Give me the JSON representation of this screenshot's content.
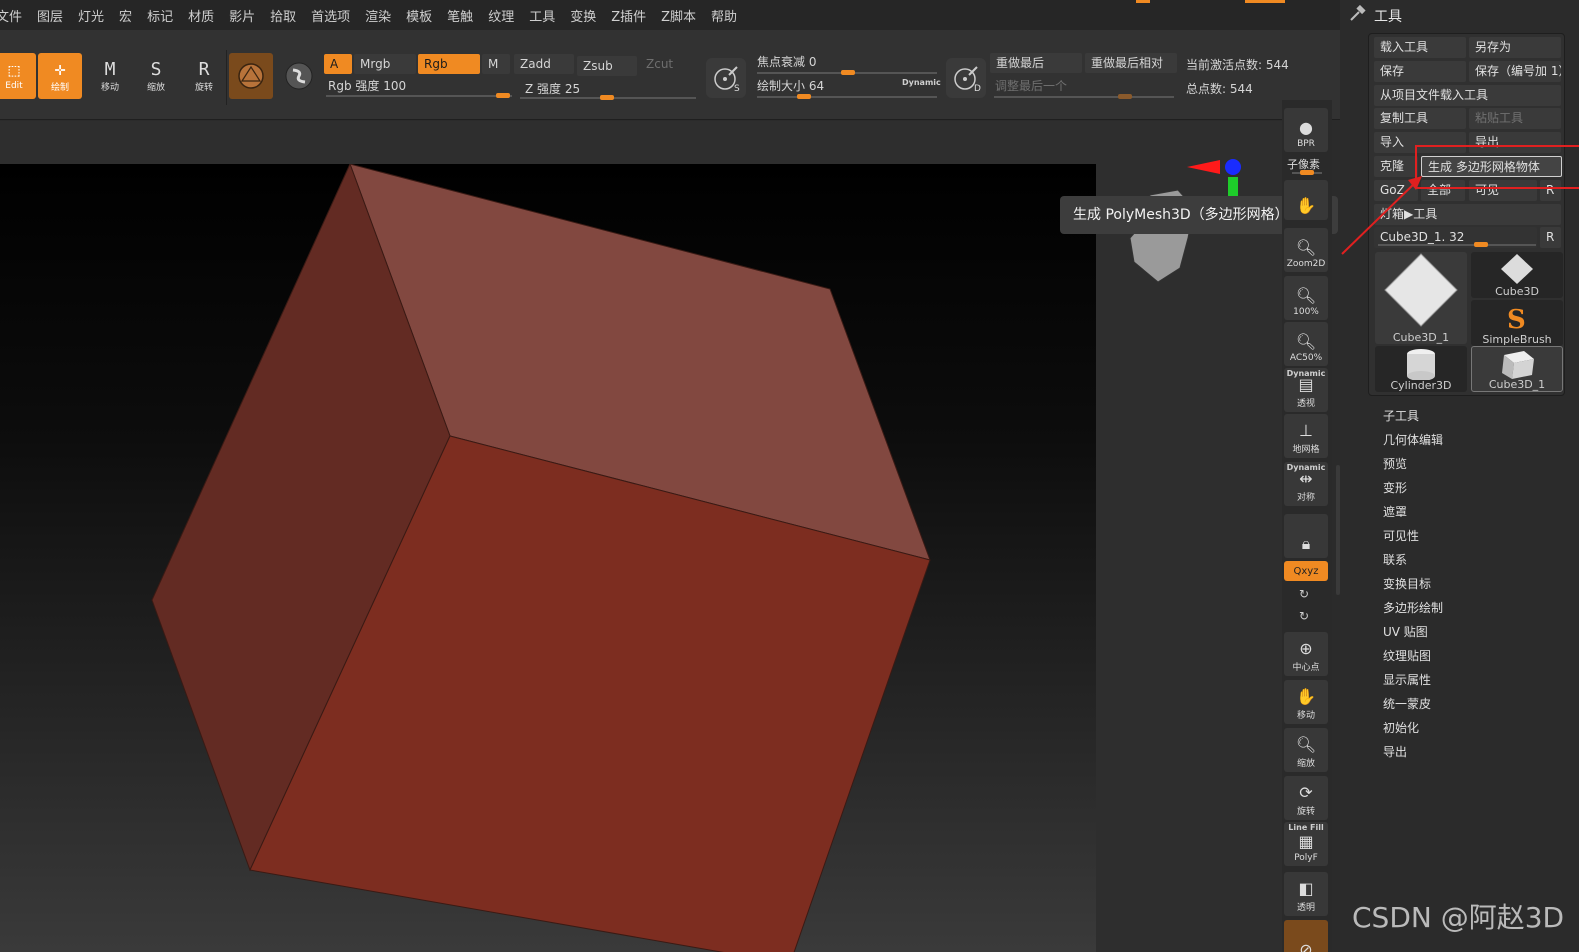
{
  "menu": [
    "文件",
    "图层",
    "灯光",
    "宏",
    "标记",
    "材质",
    "影片",
    "拾取",
    "首选项",
    "渲染",
    "模板",
    "笔触",
    "纹理",
    "工具",
    "变换",
    "Z插件",
    "Z脚本",
    "帮助"
  ],
  "toolbar": {
    "edit_label": "Edit",
    "draw_label": "绘制",
    "move_label": "移动",
    "scale_label": "缩放",
    "rotate_label": "旋转",
    "a_label": "A",
    "mrgb_label": "Mrgb",
    "rgb_label": "Rgb",
    "m_label": "M",
    "rgb_intensity": "Rgb 强度 100",
    "zadd_label": "Zadd",
    "zsub_label": "Zsub",
    "zcut_label": "Zcut",
    "z_intensity": "Z 强度 25",
    "focal_shift": "焦点衰减 0",
    "draw_size": "绘制大小 64",
    "dynamic_label": "Dynamic",
    "redo_last": "重做最后",
    "redo_last_relative": "重做最后相对",
    "adjust_last": "调整最后一个",
    "active_points": "当前激活点数: 544",
    "total_points": "总点数: 544",
    "s_label": "S",
    "d_label": "D"
  },
  "tooltip": "生成 PolyMesh3D（多边形网格）工具",
  "right_strip": {
    "bpr": "BPR",
    "subpixel": "子像素",
    "zoom2d": "Zoom2D",
    "actual": "100%",
    "ac50": "AC50%",
    "persp_dyn": "Dynamic",
    "persp": "透视",
    "floor": "地网格",
    "sym_dyn": "Dynamic",
    "sym": "对称",
    "xyz": "Qxyz",
    "center": "中心点",
    "move": "移动",
    "zoom": "缩放",
    "rotate": "旋转",
    "linefill": "Line Fill",
    "polyf": "PolyF",
    "transp": "透明"
  },
  "panel": {
    "title": "工具",
    "load_tool": "载入工具",
    "save_as": "另存为",
    "save": "保存",
    "save_inc": "保存（编号加 1）",
    "load_from_project": "从项目文件载入工具",
    "copy_tool": "复制工具",
    "paste_tool": "粘贴工具",
    "import": "导入",
    "export": "导出",
    "clone": "克隆",
    "make_polymesh": "生成 多边形网格物体",
    "goz": "GoZ",
    "all": "全部",
    "visible": "可见",
    "r": "R",
    "lightbox": "灯箱▶工具",
    "current_tool": "Cube3D_1. 32",
    "tools": [
      "Cube3D_1",
      "Cube3D",
      "SimpleBrush",
      "Cylinder3D",
      "Cube3D_1"
    ],
    "subpalettes": [
      "子工具",
      "几何体编辑",
      "预览",
      "变形",
      "遮罩",
      "可见性",
      "联系",
      "变换目标",
      "多边形绘制",
      "UV 贴图",
      "纹理贴图",
      "显示属性",
      "统一蒙皮",
      "初始化",
      "导出"
    ]
  },
  "watermark": "CSDN @阿赵3D",
  "colors": {
    "accent": "#f08a22",
    "cube_front": "#7d2d20",
    "cube_top": "#824840",
    "cube_left": "#632b23",
    "annotation_red": "#e02020"
  }
}
